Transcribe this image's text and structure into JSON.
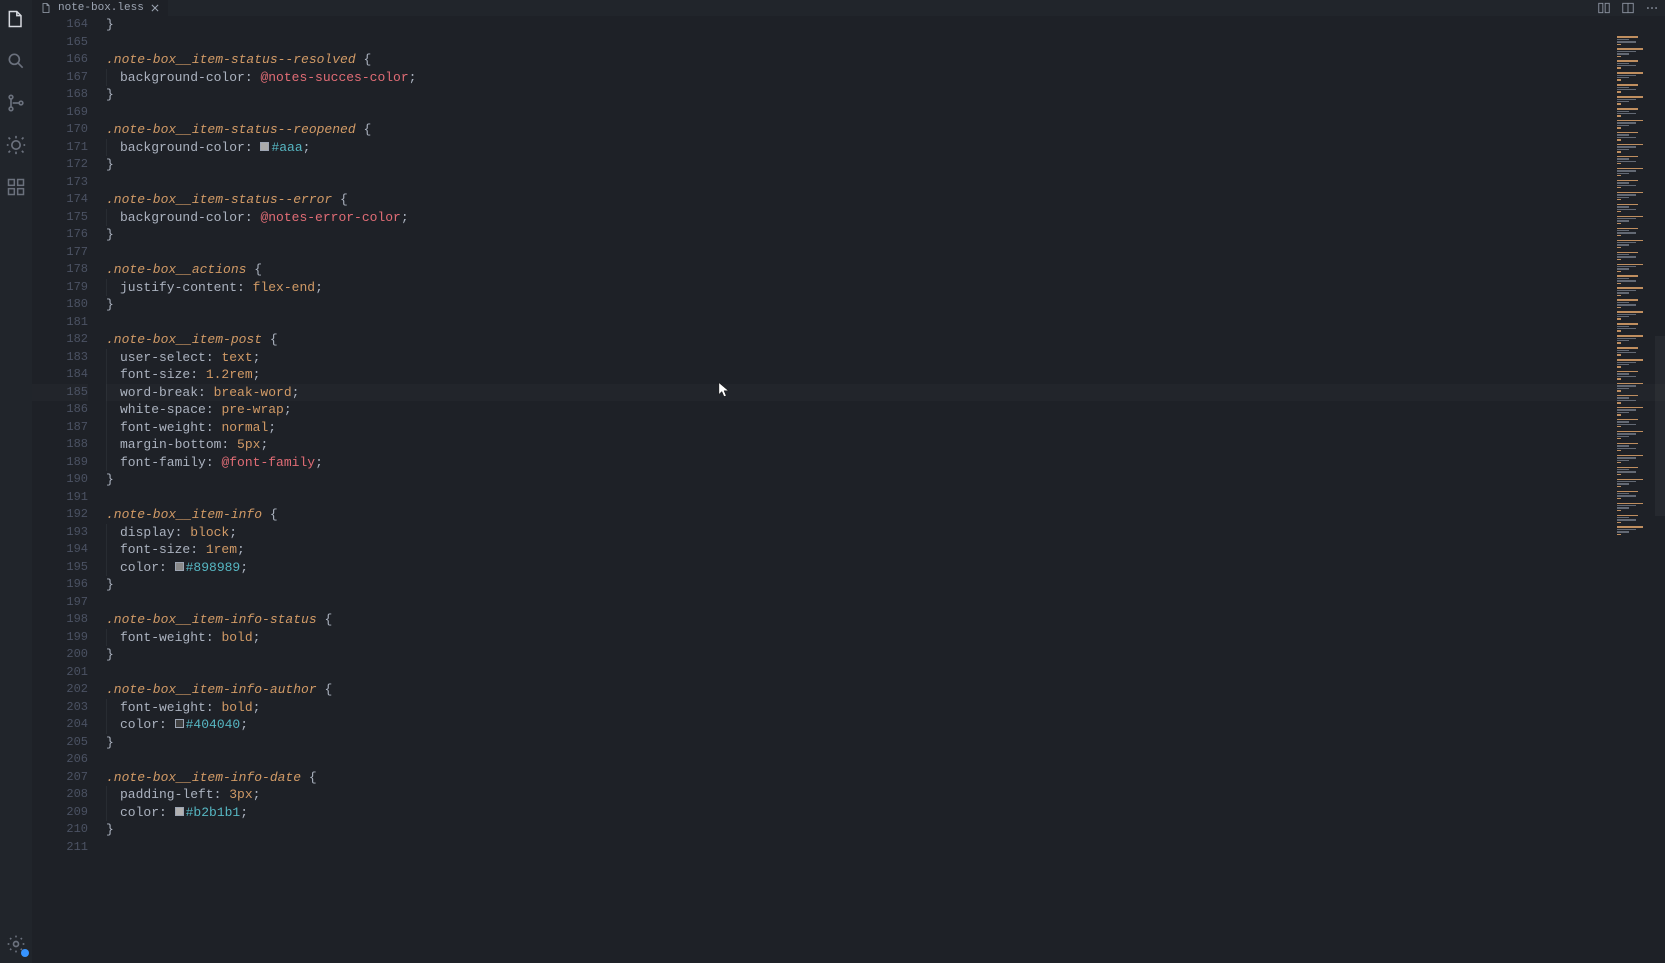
{
  "tab": {
    "fileName": "note-box.less"
  },
  "firstLineNumber": 164,
  "activeLineNumber": 185,
  "code": [
    {
      "n": 164,
      "kind": "brace",
      "indent": 0,
      "text": "}"
    },
    {
      "n": 165,
      "kind": "blank"
    },
    {
      "n": 166,
      "kind": "sel-open",
      "selector": ".note-box__item-status--resolved"
    },
    {
      "n": 167,
      "kind": "prop-var",
      "prop": "background-color",
      "var": "@notes-succes-color"
    },
    {
      "n": 168,
      "kind": "brace",
      "indent": 0,
      "text": "}"
    },
    {
      "n": 169,
      "kind": "blank"
    },
    {
      "n": 170,
      "kind": "sel-open",
      "selector": ".note-box__item-status--reopened"
    },
    {
      "n": 171,
      "kind": "prop-hex",
      "prop": "background-color",
      "hex": "#aaa",
      "swatch": "#aaaaaa"
    },
    {
      "n": 172,
      "kind": "brace",
      "indent": 0,
      "text": "}"
    },
    {
      "n": 173,
      "kind": "blank"
    },
    {
      "n": 174,
      "kind": "sel-open",
      "selector": ".note-box__item-status--error"
    },
    {
      "n": 175,
      "kind": "prop-var",
      "prop": "background-color",
      "var": "@notes-error-color"
    },
    {
      "n": 176,
      "kind": "brace",
      "indent": 0,
      "text": "}"
    },
    {
      "n": 177,
      "kind": "blank"
    },
    {
      "n": 178,
      "kind": "sel-open",
      "selector": ".note-box__actions"
    },
    {
      "n": 179,
      "kind": "prop-val",
      "prop": "justify-content",
      "val": "flex-end"
    },
    {
      "n": 180,
      "kind": "brace",
      "indent": 0,
      "text": "}"
    },
    {
      "n": 181,
      "kind": "blank"
    },
    {
      "n": 182,
      "kind": "sel-open",
      "selector": ".note-box__item-post"
    },
    {
      "n": 183,
      "kind": "prop-val",
      "prop": "user-select",
      "val": "text"
    },
    {
      "n": 184,
      "kind": "prop-val",
      "prop": "font-size",
      "val": "1.2rem"
    },
    {
      "n": 185,
      "kind": "prop-val",
      "prop": "word-break",
      "val": "break-word"
    },
    {
      "n": 186,
      "kind": "prop-val",
      "prop": "white-space",
      "val": "pre-wrap"
    },
    {
      "n": 187,
      "kind": "prop-val",
      "prop": "font-weight",
      "val": "normal"
    },
    {
      "n": 188,
      "kind": "prop-val",
      "prop": "margin-bottom",
      "val": "5px"
    },
    {
      "n": 189,
      "kind": "prop-var",
      "prop": "font-family",
      "var": "@font-family"
    },
    {
      "n": 190,
      "kind": "brace",
      "indent": 0,
      "text": "}"
    },
    {
      "n": 191,
      "kind": "blank"
    },
    {
      "n": 192,
      "kind": "sel-open",
      "selector": ".note-box__item-info"
    },
    {
      "n": 193,
      "kind": "prop-val",
      "prop": "display",
      "val": "block"
    },
    {
      "n": 194,
      "kind": "prop-val",
      "prop": "font-size",
      "val": "1rem"
    },
    {
      "n": 195,
      "kind": "prop-hex",
      "prop": "color",
      "hex": "#898989",
      "swatch": "#898989"
    },
    {
      "n": 196,
      "kind": "brace",
      "indent": 0,
      "text": "}"
    },
    {
      "n": 197,
      "kind": "blank"
    },
    {
      "n": 198,
      "kind": "sel-open",
      "selector": ".note-box__item-info-status"
    },
    {
      "n": 199,
      "kind": "prop-val",
      "prop": "font-weight",
      "val": "bold"
    },
    {
      "n": 200,
      "kind": "brace",
      "indent": 0,
      "text": "}"
    },
    {
      "n": 201,
      "kind": "blank"
    },
    {
      "n": 202,
      "kind": "sel-open",
      "selector": ".note-box__item-info-author"
    },
    {
      "n": 203,
      "kind": "prop-val",
      "prop": "font-weight",
      "val": "bold"
    },
    {
      "n": 204,
      "kind": "prop-hex",
      "prop": "color",
      "hex": "#404040",
      "swatch": "#404040"
    },
    {
      "n": 205,
      "kind": "brace",
      "indent": 0,
      "text": "}"
    },
    {
      "n": 206,
      "kind": "blank"
    },
    {
      "n": 207,
      "kind": "sel-open",
      "selector": ".note-box__item-info-date"
    },
    {
      "n": 208,
      "kind": "prop-val",
      "prop": "padding-left",
      "val": "3px"
    },
    {
      "n": 209,
      "kind": "prop-hex",
      "prop": "color",
      "hex": "#b2b1b1",
      "swatch": "#b2b1b1"
    },
    {
      "n": 210,
      "kind": "brace",
      "indent": 0,
      "text": "}"
    },
    {
      "n": 211,
      "kind": "blank"
    }
  ]
}
